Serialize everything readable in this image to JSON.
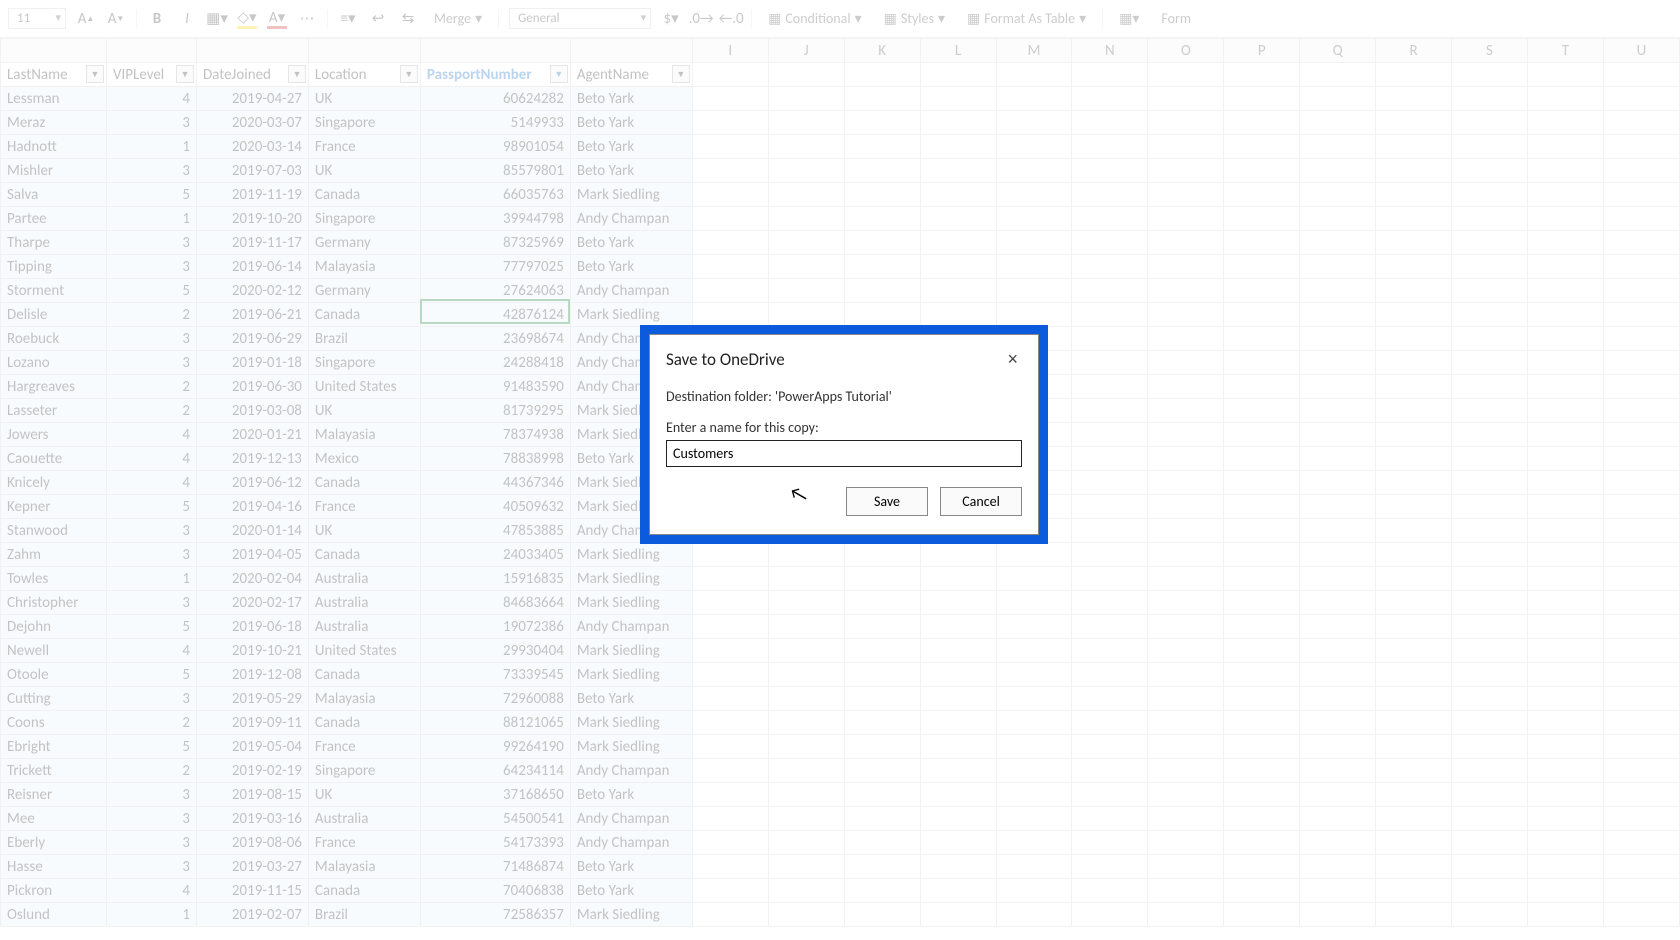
{
  "toolbar": {
    "font_size": "11",
    "number_format": "General",
    "conditional": "Conditional",
    "styles": "Styles",
    "format_table": "Format As Table",
    "merge": "Merge",
    "form": "Form"
  },
  "columns": {
    "letters": [
      "I",
      "J",
      "K",
      "L",
      "M",
      "N",
      "O",
      "P",
      "Q",
      "R",
      "S",
      "T",
      "U"
    ],
    "headers": [
      "LastName",
      "VIPLevel",
      "DateJoined",
      "Location",
      "PassportNumber",
      "AgentName"
    ],
    "active_header_index": 4
  },
  "rows": [
    {
      "LastName": "Lessman",
      "VIPLevel": "4",
      "DateJoined": "2019-04-27",
      "Location": "UK",
      "PassportNumber": "60624282",
      "AgentName": "Beto Yark"
    },
    {
      "LastName": "Meraz",
      "VIPLevel": "3",
      "DateJoined": "2020-03-07",
      "Location": "Singapore",
      "PassportNumber": "5149933",
      "AgentName": "Beto Yark"
    },
    {
      "LastName": "Hadnott",
      "VIPLevel": "1",
      "DateJoined": "2020-03-14",
      "Location": "France",
      "PassportNumber": "98901054",
      "AgentName": "Beto Yark"
    },
    {
      "LastName": "Mishler",
      "VIPLevel": "3",
      "DateJoined": "2019-07-03",
      "Location": "UK",
      "PassportNumber": "85579801",
      "AgentName": "Beto Yark"
    },
    {
      "LastName": "Salva",
      "VIPLevel": "5",
      "DateJoined": "2019-11-19",
      "Location": "Canada",
      "PassportNumber": "66035763",
      "AgentName": "Mark Siedling"
    },
    {
      "LastName": "Partee",
      "VIPLevel": "1",
      "DateJoined": "2019-10-20",
      "Location": "Singapore",
      "PassportNumber": "39944798",
      "AgentName": "Andy Champan"
    },
    {
      "LastName": "Tharpe",
      "VIPLevel": "3",
      "DateJoined": "2019-11-17",
      "Location": "Germany",
      "PassportNumber": "87325969",
      "AgentName": "Beto Yark"
    },
    {
      "LastName": "Tipping",
      "VIPLevel": "3",
      "DateJoined": "2019-06-14",
      "Location": "Malayasia",
      "PassportNumber": "77797025",
      "AgentName": "Beto Yark"
    },
    {
      "LastName": "Storment",
      "VIPLevel": "5",
      "DateJoined": "2020-02-12",
      "Location": "Germany",
      "PassportNumber": "27624063",
      "AgentName": "Andy Champan"
    },
    {
      "LastName": "Delisle",
      "VIPLevel": "2",
      "DateJoined": "2019-06-21",
      "Location": "Canada",
      "PassportNumber": "42876124",
      "AgentName": "Mark Siedling"
    },
    {
      "LastName": "Roebuck",
      "VIPLevel": "3",
      "DateJoined": "2019-06-29",
      "Location": "Brazil",
      "PassportNumber": "23698674",
      "AgentName": "Andy Champan"
    },
    {
      "LastName": "Lozano",
      "VIPLevel": "3",
      "DateJoined": "2019-01-18",
      "Location": "Singapore",
      "PassportNumber": "24288418",
      "AgentName": "Andy Champan"
    },
    {
      "LastName": "Hargreaves",
      "VIPLevel": "2",
      "DateJoined": "2019-06-30",
      "Location": "United States",
      "PassportNumber": "91483590",
      "AgentName": "Andy Champan"
    },
    {
      "LastName": "Lasseter",
      "VIPLevel": "2",
      "DateJoined": "2019-03-08",
      "Location": "UK",
      "PassportNumber": "81739295",
      "AgentName": "Mark Siedling"
    },
    {
      "LastName": "Jowers",
      "VIPLevel": "4",
      "DateJoined": "2020-01-21",
      "Location": "Malayasia",
      "PassportNumber": "78374938",
      "AgentName": "Mark Siedling"
    },
    {
      "LastName": "Caouette",
      "VIPLevel": "4",
      "DateJoined": "2019-12-13",
      "Location": "Mexico",
      "PassportNumber": "78838998",
      "AgentName": "Beto Yark"
    },
    {
      "LastName": "Knicely",
      "VIPLevel": "4",
      "DateJoined": "2019-06-12",
      "Location": "Canada",
      "PassportNumber": "44367346",
      "AgentName": "Mark Siedling"
    },
    {
      "LastName": "Kepner",
      "VIPLevel": "5",
      "DateJoined": "2019-04-16",
      "Location": "France",
      "PassportNumber": "40509632",
      "AgentName": "Mark Siedling"
    },
    {
      "LastName": "Stanwood",
      "VIPLevel": "3",
      "DateJoined": "2020-01-14",
      "Location": "UK",
      "PassportNumber": "47853885",
      "AgentName": "Andy Champan"
    },
    {
      "LastName": "Zahm",
      "VIPLevel": "3",
      "DateJoined": "2019-04-05",
      "Location": "Canada",
      "PassportNumber": "24033405",
      "AgentName": "Mark Siedling"
    },
    {
      "LastName": "Towles",
      "VIPLevel": "1",
      "DateJoined": "2020-02-04",
      "Location": "Australia",
      "PassportNumber": "15916835",
      "AgentName": "Mark Siedling"
    },
    {
      "LastName": "Christopher",
      "VIPLevel": "3",
      "DateJoined": "2020-02-17",
      "Location": "Australia",
      "PassportNumber": "84683664",
      "AgentName": "Mark Siedling"
    },
    {
      "LastName": "Dejohn",
      "VIPLevel": "5",
      "DateJoined": "2019-06-18",
      "Location": "Australia",
      "PassportNumber": "19072386",
      "AgentName": "Andy Champan"
    },
    {
      "LastName": "Newell",
      "VIPLevel": "4",
      "DateJoined": "2019-10-21",
      "Location": "United States",
      "PassportNumber": "29930404",
      "AgentName": "Mark Siedling"
    },
    {
      "LastName": "Otoole",
      "VIPLevel": "5",
      "DateJoined": "2019-12-08",
      "Location": "Canada",
      "PassportNumber": "73339545",
      "AgentName": "Mark Siedling"
    },
    {
      "LastName": "Cutting",
      "VIPLevel": "3",
      "DateJoined": "2019-05-29",
      "Location": "Malayasia",
      "PassportNumber": "72960088",
      "AgentName": "Beto Yark"
    },
    {
      "LastName": "Coons",
      "VIPLevel": "2",
      "DateJoined": "2019-09-11",
      "Location": "Canada",
      "PassportNumber": "88121065",
      "AgentName": "Mark Siedling"
    },
    {
      "LastName": "Ebright",
      "VIPLevel": "5",
      "DateJoined": "2019-05-04",
      "Location": "France",
      "PassportNumber": "99264190",
      "AgentName": "Mark Siedling"
    },
    {
      "LastName": "Trickett",
      "VIPLevel": "2",
      "DateJoined": "2019-02-19",
      "Location": "Singapore",
      "PassportNumber": "64234114",
      "AgentName": "Andy Champan"
    },
    {
      "LastName": "Reisner",
      "VIPLevel": "3",
      "DateJoined": "2019-08-15",
      "Location": "UK",
      "PassportNumber": "37168650",
      "AgentName": "Beto Yark"
    },
    {
      "LastName": "Mee",
      "VIPLevel": "3",
      "DateJoined": "2019-03-16",
      "Location": "Australia",
      "PassportNumber": "54500541",
      "AgentName": "Andy Champan"
    },
    {
      "LastName": "Eberly",
      "VIPLevel": "3",
      "DateJoined": "2019-08-06",
      "Location": "France",
      "PassportNumber": "54173393",
      "AgentName": "Andy Champan"
    },
    {
      "LastName": "Hasse",
      "VIPLevel": "3",
      "DateJoined": "2019-03-27",
      "Location": "Malayasia",
      "PassportNumber": "71486874",
      "AgentName": "Beto Yark"
    },
    {
      "LastName": "Pickron",
      "VIPLevel": "4",
      "DateJoined": "2019-11-15",
      "Location": "Canada",
      "PassportNumber": "70406838",
      "AgentName": "Beto Yark"
    },
    {
      "LastName": "Oslund",
      "VIPLevel": "1",
      "DateJoined": "2019-02-07",
      "Location": "Brazil",
      "PassportNumber": "72586357",
      "AgentName": "Mark Siedling"
    }
  ],
  "dialog": {
    "title": "Save to OneDrive",
    "destination_label": "Destination folder: 'PowerApps Tutorial'",
    "prompt": "Enter a name for this copy:",
    "input_value": "Customers",
    "save": "Save",
    "cancel": "Cancel"
  }
}
